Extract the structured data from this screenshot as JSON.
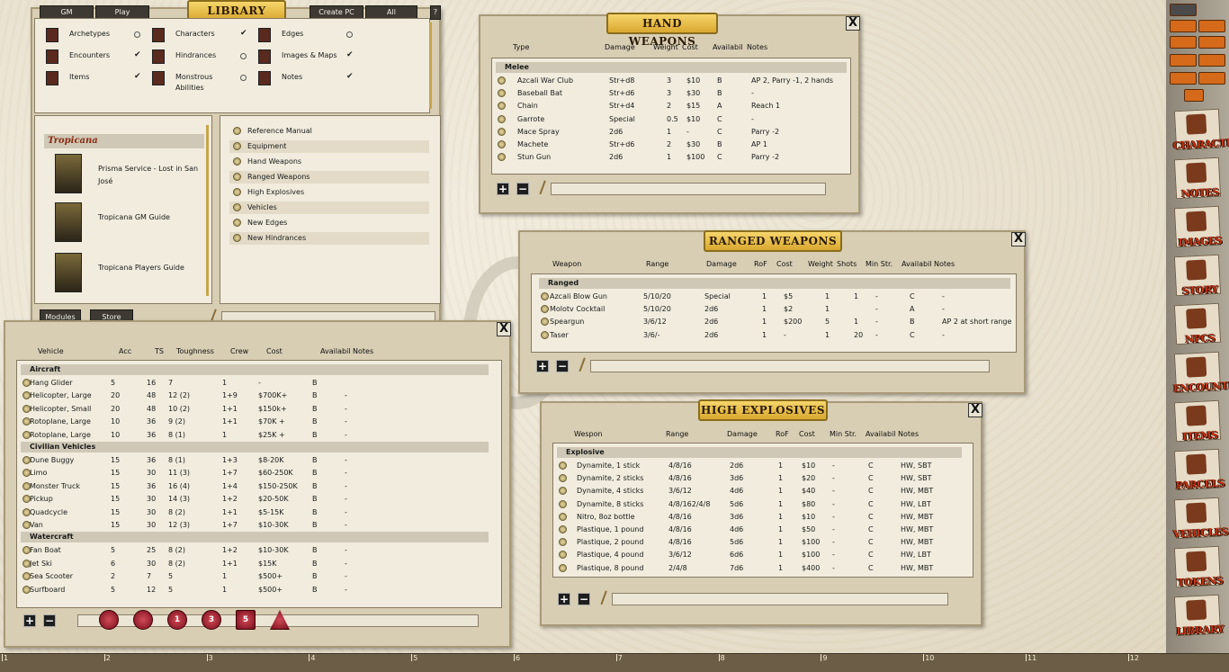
{
  "library": {
    "title": "Library",
    "top_buttons": [
      "GM",
      "Play",
      "Create PC",
      "All"
    ],
    "help_label": "?",
    "categories": [
      {
        "label": "Archetypes",
        "state": "dot"
      },
      {
        "label": "Characters",
        "state": "check"
      },
      {
        "label": "Edges",
        "state": "dot"
      },
      {
        "label": "Encounters",
        "state": "check"
      },
      {
        "label": "Hindrances",
        "state": "dot"
      },
      {
        "label": "Images & Maps",
        "state": "check"
      },
      {
        "label": "Items",
        "state": "check"
      },
      {
        "label": "Monstrous",
        "label2": "Abilities",
        "state": "dot"
      },
      {
        "label": "Notes",
        "state": "check"
      }
    ],
    "module_title": "Tropicana",
    "books": [
      "Prisma Service - Lost in San",
      "José",
      "Tropicana GM Guide",
      "Tropicana Players Guide"
    ],
    "links": [
      "Reference Manual",
      "Equipment",
      "Hand Weapons",
      "Ranged Weapons",
      "High Explosives",
      "Vehicles",
      "New Edges",
      "New Hindrances"
    ],
    "bottom_buttons": [
      "Modules",
      "Store"
    ]
  },
  "hand_weapons": {
    "title": "Hand Weapons",
    "close": "X",
    "headers": [
      "Type",
      "Damage",
      "Weight",
      "Cost",
      "Availabil",
      "Notes"
    ],
    "group": "Melee",
    "rows": [
      [
        "Azcali War Club",
        "Str+d8",
        "3",
        "$10",
        "B",
        "AP 2, Parry -1, 2 hands"
      ],
      [
        "Baseball Bat",
        "Str+d6",
        "3",
        "$30",
        "B",
        "-"
      ],
      [
        "Chain",
        "Str+d4",
        "2",
        "$15",
        "A",
        "Reach 1"
      ],
      [
        "Garrote",
        "Special",
        "0.5",
        "$10",
        "C",
        "-"
      ],
      [
        "Mace Spray",
        "2d6",
        "1",
        "-",
        "C",
        "Parry -2"
      ],
      [
        "Machete",
        "Str+d6",
        "2",
        "$30",
        "B",
        "AP 1"
      ],
      [
        "Stun Gun",
        "2d6",
        "1",
        "$100",
        "C",
        "Parry -2"
      ]
    ]
  },
  "ranged_weapons": {
    "title": "Ranged Weapons",
    "close": "X",
    "headers": [
      "Weapon",
      "Range",
      "Damage",
      "RoF",
      "Cost",
      "Weight",
      "Shots",
      "Min Str.",
      "Availabil",
      "Notes"
    ],
    "group": "Ranged",
    "rows": [
      [
        "Azcali Blow Gun",
        "5/10/20",
        "Special",
        "1",
        "$5",
        "1",
        "1",
        "-",
        "C",
        "-"
      ],
      [
        "Molotv Cocktail",
        "5/10/20",
        "2d6",
        "1",
        "$2",
        "1",
        "",
        "-",
        "A",
        "-"
      ],
      [
        "Speargun",
        "3/6/12",
        "2d6",
        "1",
        "$200",
        "5",
        "1",
        "-",
        "B",
        "AP 2 at short range"
      ],
      [
        "Taser",
        "3/6/-",
        "2d6",
        "1",
        "-",
        "1",
        "20",
        "-",
        "C",
        "-"
      ]
    ]
  },
  "high_explosives": {
    "title": "High Explosives",
    "close": "X",
    "headers": [
      "Wespon",
      "Range",
      "Damage",
      "RoF",
      "Cost",
      "Min Str.",
      "Availabil",
      "Notes"
    ],
    "group": "Explosive",
    "rows": [
      [
        "Dynamite, 1 stick",
        "4/8/16",
        "2d6",
        "1",
        "$10",
        "-",
        "C",
        "HW, SBT"
      ],
      [
        "Dynamite, 2 sticks",
        "4/8/16",
        "3d6",
        "1",
        "$20",
        "-",
        "C",
        "HW, SBT"
      ],
      [
        "Dynamite, 4 sticks",
        "3/6/12",
        "4d6",
        "1",
        "$40",
        "-",
        "C",
        "HW, MBT"
      ],
      [
        "Dynamite, 8 sticks",
        "4/8/162/4/8",
        "5d6",
        "1",
        "$80",
        "-",
        "C",
        "HW, LBT"
      ],
      [
        "Nitro, 8oz bottle",
        "4/8/16",
        "3d6",
        "1",
        "$10",
        "-",
        "C",
        "HW, MBT"
      ],
      [
        "Plastique, 1 pound",
        "4/8/16",
        "4d6",
        "1",
        "$50",
        "-",
        "C",
        "HW, MBT"
      ],
      [
        "Plastique, 2 pound",
        "4/8/16",
        "5d6",
        "1",
        "$100",
        "-",
        "C",
        "HW, MBT"
      ],
      [
        "Plastique, 4 pound",
        "3/6/12",
        "6d6",
        "1",
        "$100",
        "-",
        "C",
        "HW, LBT"
      ],
      [
        "Plastique, 8 pound",
        "2/4/8",
        "7d6",
        "1",
        "$400",
        "-",
        "C",
        "HW, MBT"
      ]
    ]
  },
  "vehicles": {
    "close": "X",
    "headers": [
      "Vehicle",
      "Acc",
      "TS",
      "Toughness",
      "Crew",
      "Cost",
      "Availabil",
      "Notes"
    ],
    "groups": [
      {
        "name": "Aircraft",
        "rows": [
          [
            "Hang Glider",
            "5",
            "16",
            "7",
            "1",
            "-",
            "B",
            ""
          ],
          [
            "Helicopter, Large",
            "20",
            "48",
            "12 (2)",
            "1+9",
            "$700K+",
            "B",
            "-"
          ],
          [
            "Helicopter, Small",
            "20",
            "48",
            "10 (2)",
            "1+1",
            "$150k+",
            "B",
            "-"
          ],
          [
            "Rotoplane, Large",
            "10",
            "36",
            "9 (2)",
            "1+1",
            "$70K +",
            "B",
            "-"
          ],
          [
            "Rotoplane, Large",
            "10",
            "36",
            "8 (1)",
            "1",
            "$25K +",
            "B",
            "-"
          ]
        ]
      },
      {
        "name": "Civilian Vehicles",
        "rows": [
          [
            "Dune Buggy",
            "15",
            "36",
            "8 (1)",
            "1+3",
            "$8-20K",
            "B",
            "-"
          ],
          [
            "Limo",
            "15",
            "30",
            "11 (3)",
            "1+7",
            "$60-250K",
            "B",
            "-"
          ],
          [
            "Monster Truck",
            "15",
            "36",
            "16 (4)",
            "1+4",
            "$150-250K",
            "B",
            "-"
          ],
          [
            "Pickup",
            "15",
            "30",
            "14 (3)",
            "1+2",
            "$20-50K",
            "B",
            "-"
          ],
          [
            "Quadcycle",
            "15",
            "30",
            "8 (2)",
            "1+1",
            "$5-15K",
            "B",
            "-"
          ],
          [
            "Van",
            "15",
            "30",
            "12 (3)",
            "1+7",
            "$10-30K",
            "B",
            "-"
          ]
        ]
      },
      {
        "name": "Watercraft",
        "rows": [
          [
            "Fan Boat",
            "5",
            "25",
            "8 (2)",
            "1+2",
            "$10-30K",
            "B",
            "-"
          ],
          [
            "Jet Ski",
            "6",
            "30",
            "8 (2)",
            "1+1",
            "$15K",
            "B",
            "-"
          ],
          [
            "Sea Scooter",
            "2",
            "7",
            "5",
            "1",
            "$500+",
            "B",
            "-"
          ],
          [
            "Surfboard",
            "5",
            "12",
            "5",
            "1",
            "$500+",
            "B",
            "-"
          ]
        ]
      }
    ]
  },
  "dice": [
    "d20",
    "d12",
    "d10",
    "d8",
    "d6",
    "d4"
  ],
  "dice_labels": [
    "",
    "",
    "1",
    "3",
    "5",
    ""
  ],
  "sidebar_tabs": [
    "Characters",
    "Notes",
    "Images",
    "Story",
    "NPCs",
    "Encounters",
    "Items",
    "Parcels",
    "Vehicles",
    "Tokens",
    "Library"
  ],
  "ruler": [
    "1",
    "2",
    "3",
    "4",
    "5",
    "6",
    "7",
    "8",
    "9",
    "10",
    "11",
    "12"
  ]
}
